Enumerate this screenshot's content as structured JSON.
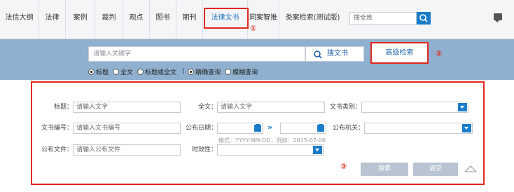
{
  "nav": {
    "items": [
      "法信大纲",
      "法律",
      "案例",
      "裁判",
      "观点",
      "图书",
      "期刊",
      "法律文书",
      "同案智推",
      "类案检索(测试版)"
    ],
    "active_index": 7,
    "search_placeholder": "搜全库",
    "marker_1": "①"
  },
  "search": {
    "placeholder": "请输入关键字",
    "search_button": "搜文书",
    "advanced_button": "高级检索",
    "marker_2": "②",
    "scope_options": [
      "标题",
      "全文",
      "标题或全文"
    ],
    "match_options": [
      "精确查询",
      "模糊查询"
    ],
    "separator": "|"
  },
  "advanced": {
    "marker_3": "③",
    "title_label": "标题：",
    "title_placeholder": "请输入文字",
    "fulltext_label": "全文：",
    "fulltext_placeholder": "请输入文字",
    "doctype_label": "文书类别：",
    "docno_label": "文书编号：",
    "docno_placeholder": "请输入文书编号",
    "pubdate_label": "公布日期：",
    "pubagency_label": "公布机关：",
    "pubfile_label": "公布文件：",
    "pubfile_placeholder": "请输入公布文件",
    "validity_label": "时效性：",
    "date_hint": "格式：YYYY-MM-DD，例如：2015-07-06",
    "search_button": "搜索",
    "clear_button": "清空",
    "date_range_glyph": "»"
  },
  "colors": {
    "accent": "#1b7cc9",
    "band": "#8fb0cf",
    "highlight_red": "#e0281e",
    "disabled_button": "#b8c4d1"
  }
}
